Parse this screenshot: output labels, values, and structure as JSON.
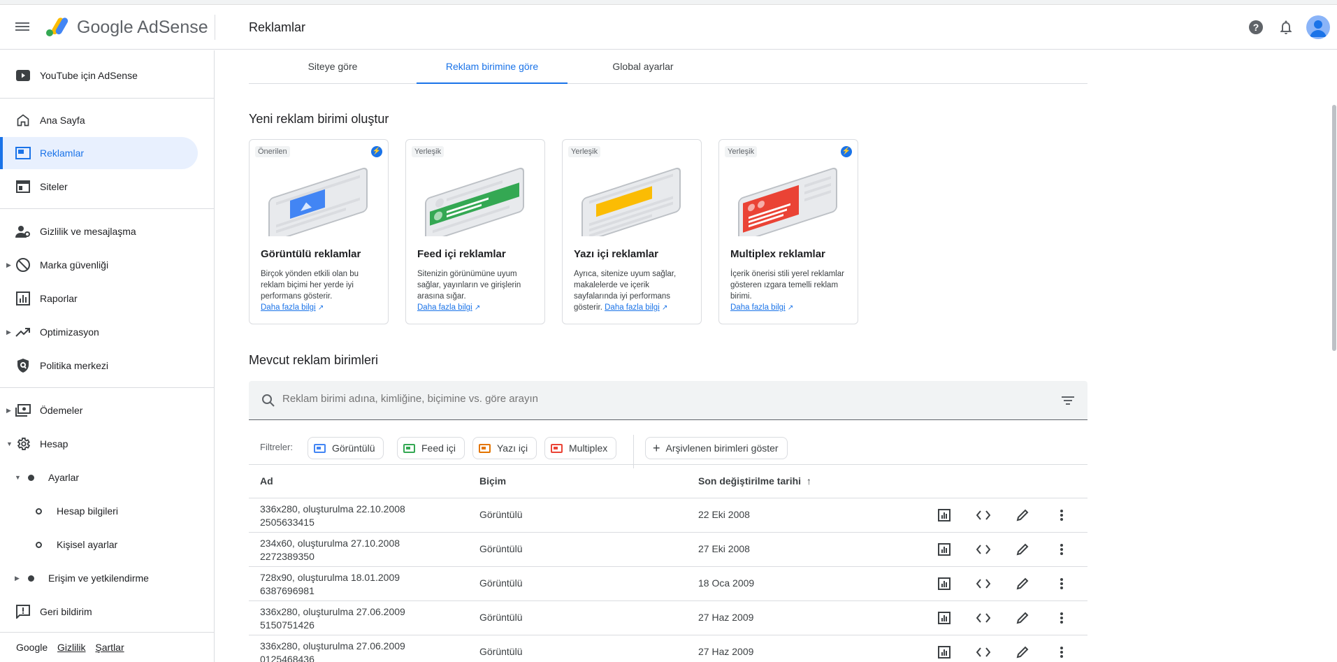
{
  "header": {
    "brand": "Google AdSense",
    "page_title": "Reklamlar"
  },
  "sidebar": {
    "top_item": "YouTube için AdSense",
    "items": [
      {
        "label": "Ana Sayfa"
      },
      {
        "label": "Reklamlar"
      },
      {
        "label": "Siteler"
      },
      {
        "label": "Gizlilik ve mesajlaşma"
      },
      {
        "label": "Marka güvenliği"
      },
      {
        "label": "Raporlar"
      },
      {
        "label": "Optimizasyon"
      },
      {
        "label": "Politika merkezi"
      },
      {
        "label": "Ödemeler"
      },
      {
        "label": "Hesap"
      },
      {
        "label": "Ayarlar"
      },
      {
        "label": "Hesap bilgileri"
      },
      {
        "label": "Kişisel ayarlar"
      },
      {
        "label": "Erişim ve yetkilendirme"
      },
      {
        "label": "Geri bildirim"
      }
    ],
    "footer": {
      "google": "Google",
      "privacy": "Gizlilik",
      "terms": "Şartlar"
    }
  },
  "tabs": [
    "Siteye göre",
    "Reklam birimine göre",
    "Global ayarlar"
  ],
  "create_section": {
    "title": "Yeni reklam birimi oluştur",
    "cards": [
      {
        "badge": "Önerilen",
        "title": "Görüntülü reklamlar",
        "desc": "Birçok yönden etkili olan bu reklam biçimi her yerde iyi performans gösterir.",
        "link": "Daha fazla bilgi",
        "color": "#4285f4"
      },
      {
        "badge": "Yerleşik",
        "title": "Feed içi reklamlar",
        "desc": "Sitenizin görünümüne uyum sağlar, yayınların ve girişlerin arasına sığar.",
        "link": "Daha fazla bilgi",
        "color": "#34a853"
      },
      {
        "badge": "Yerleşik",
        "title": "Yazı içi reklamlar",
        "desc": "Ayrıca, sitenize uyum sağlar, makalelerde ve içerik sayfalarında iyi performans gösterir.",
        "link": "Daha fazla bilgi",
        "color": "#fbbc04"
      },
      {
        "badge": "Yerleşik",
        "title": "Multiplex reklamlar",
        "desc": "İçerik önerisi stili yerel reklamlar gösteren ızgara temelli reklam birimi.",
        "link": "Daha fazla bilgi",
        "color": "#ea4335"
      }
    ]
  },
  "existing_section": {
    "title": "Mevcut reklam birimleri",
    "search_placeholder": "Reklam birimi adına, kimliğine, biçimine vs. göre arayın",
    "filters_label": "Filtreler:",
    "filter_chips": [
      {
        "label": "Görüntülü",
        "color": "#4285f4"
      },
      {
        "label": "Feed içi",
        "color": "#34a853"
      },
      {
        "label": "Yazı içi",
        "color": "#e37400"
      },
      {
        "label": "Multiplex",
        "color": "#ea4335"
      }
    ],
    "archive_button": "Arşivlenen birimleri göster",
    "columns": [
      "Ad",
      "Biçim",
      "Son değiştirilme tarihi"
    ],
    "rows": [
      {
        "name": "336x280, oluşturulma 22.10.2008",
        "id": "2505633415",
        "format": "Görüntülü",
        "date": "22 Eki 2008"
      },
      {
        "name": "234x60, oluşturulma 27.10.2008",
        "id": "2272389350",
        "format": "Görüntülü",
        "date": "27 Eki 2008"
      },
      {
        "name": "728x90, oluşturulma 18.01.2009",
        "id": "6387696981",
        "format": "Görüntülü",
        "date": "18 Oca 2009"
      },
      {
        "name": "336x280, oluşturulma 27.06.2009",
        "id": "5150751426",
        "format": "Görüntülü",
        "date": "27 Haz 2009"
      },
      {
        "name": "336x280, oluşturulma 27.06.2009",
        "id": "0125468436",
        "format": "Görüntülü",
        "date": "27 Haz 2009"
      }
    ]
  }
}
